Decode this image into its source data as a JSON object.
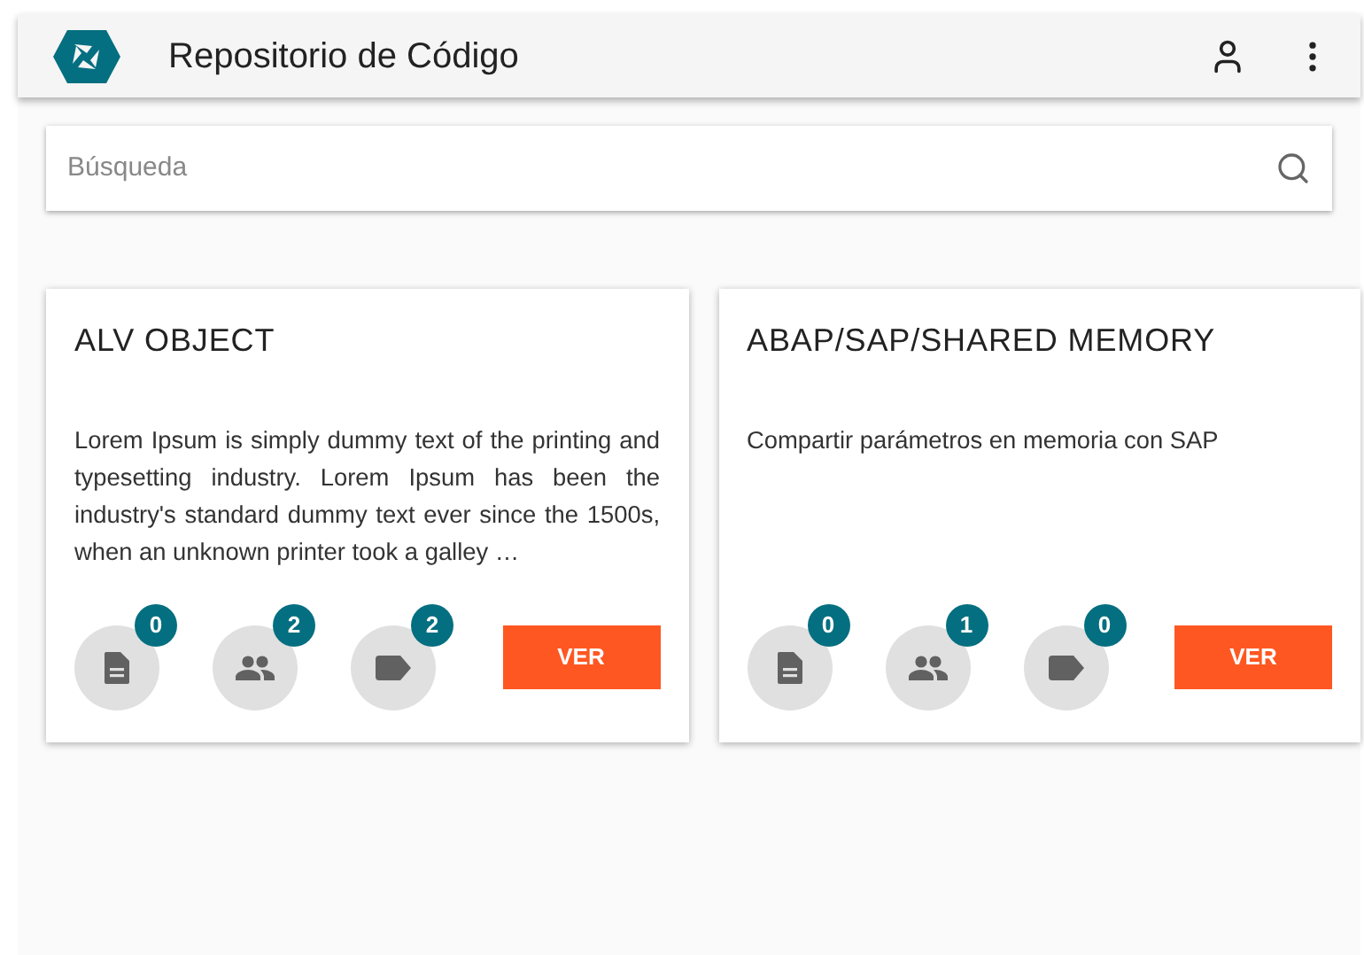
{
  "app_bar": {
    "title": "Repositorio de Código"
  },
  "search": {
    "placeholder": "Búsqueda"
  },
  "cards": [
    {
      "title": "ALV OBJECT",
      "description": "Lorem Ipsum is simply dummy text of the printing and typesetting industry. Lorem Ipsum has been the industry's standard dummy text ever since the 1500s, when an unknown printer took a galley …",
      "counters": [
        {
          "kind": "document",
          "count": "0"
        },
        {
          "kind": "people",
          "count": "2"
        },
        {
          "kind": "label",
          "count": "2"
        }
      ],
      "button": "VER"
    },
    {
      "title": "ABAP/SAP/SHARED MEMORY",
      "description": "Compartir parámetros en memoria con SAP",
      "counters": [
        {
          "kind": "document",
          "count": "0"
        },
        {
          "kind": "people",
          "count": "1"
        },
        {
          "kind": "label",
          "count": "0"
        }
      ],
      "button": "VER"
    }
  ]
}
